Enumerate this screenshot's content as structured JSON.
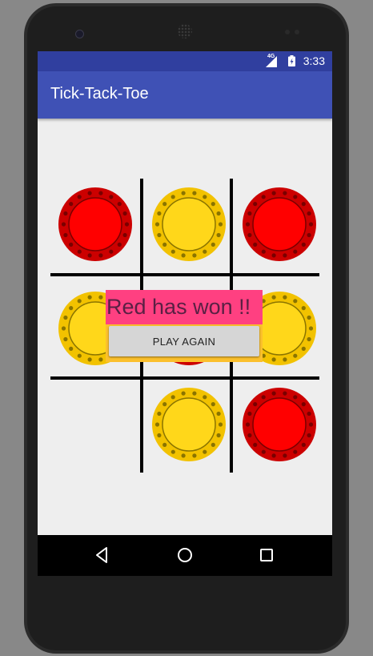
{
  "status_bar": {
    "time": "3:33",
    "network": "4G",
    "icons": [
      "signal-icon",
      "battery-icon"
    ]
  },
  "app_bar": {
    "title": "Tick-Tack-Toe"
  },
  "board": {
    "cells": [
      "red",
      "yellow",
      "red",
      "yellow",
      "red",
      "yellow",
      "empty",
      "yellow",
      "red"
    ],
    "colors": {
      "red": "#ff0000",
      "red_rim": "#cc0000",
      "yellow": "#ffd71a",
      "yellow_rim": "#f2c200",
      "grid": "#000000"
    }
  },
  "winner": {
    "message": "Red has won !!",
    "button_label": "PLAY AGAIN",
    "message_bg": "#ff4081",
    "panel_bg": "#fbc02d"
  },
  "nav_bar": {
    "icons": [
      "back-icon",
      "home-icon",
      "recents-icon"
    ]
  }
}
